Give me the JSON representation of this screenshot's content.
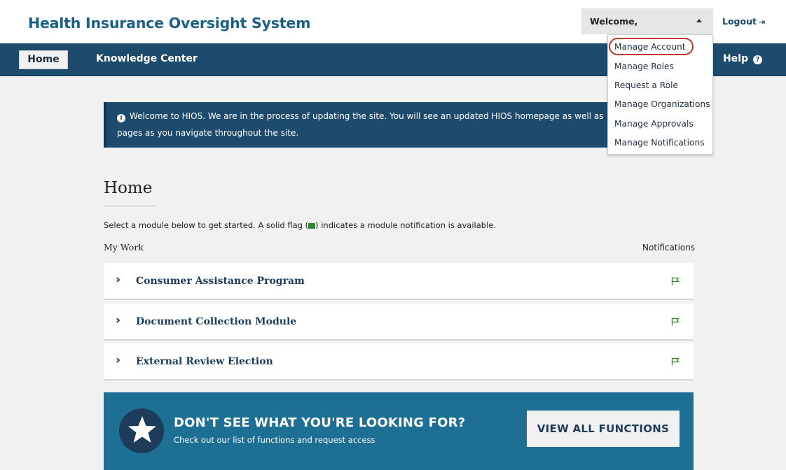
{
  "header": {
    "site_title": "Health Insurance Oversight System",
    "welcome_label": "Welcome,",
    "logout_label": "Logout"
  },
  "nav": {
    "home_label": "Home",
    "knowledge_center_label": "Knowledge Center",
    "help_label": "Help"
  },
  "account_menu": {
    "items": [
      {
        "label": "Manage Account",
        "highlighted": true
      },
      {
        "label": "Manage Roles"
      },
      {
        "label": "Request a Role"
      },
      {
        "label": "Manage Organizations"
      },
      {
        "label": "Manage Approvals"
      },
      {
        "label": "Manage Notifications"
      }
    ]
  },
  "info_banner": {
    "line1": "Welcome to HIOS. We are in the process of updating the site. You will see an updated HIOS homepage as well as",
    "line2": "pages as you navigate throughout the site."
  },
  "main": {
    "title": "Home",
    "intro_before": "Select a module below to get started. A solid flag (",
    "intro_after": ") indicates a module notification is available.",
    "my_work_label": "My Work",
    "notifications_label": "Notifications",
    "modules": [
      {
        "label": "Consumer Assistance Program",
        "notification": "outline-flag"
      },
      {
        "label": "Document Collection Module",
        "notification": "outline-flag"
      },
      {
        "label": "External Review Election",
        "notification": "outline-flag"
      }
    ]
  },
  "promo": {
    "title": "DON'T SEE WHAT YOU'RE LOOKING FOR?",
    "subtitle": "Check out our list of functions and request access",
    "button_label": "VIEW ALL FUNCTIONS"
  },
  "colors": {
    "brand_blue": "#1a5f85",
    "nav_blue": "#1d4b6e",
    "promo_blue": "#1d6f94",
    "flag_green": "#2a8a2a",
    "highlight_red": "#c0392b"
  }
}
